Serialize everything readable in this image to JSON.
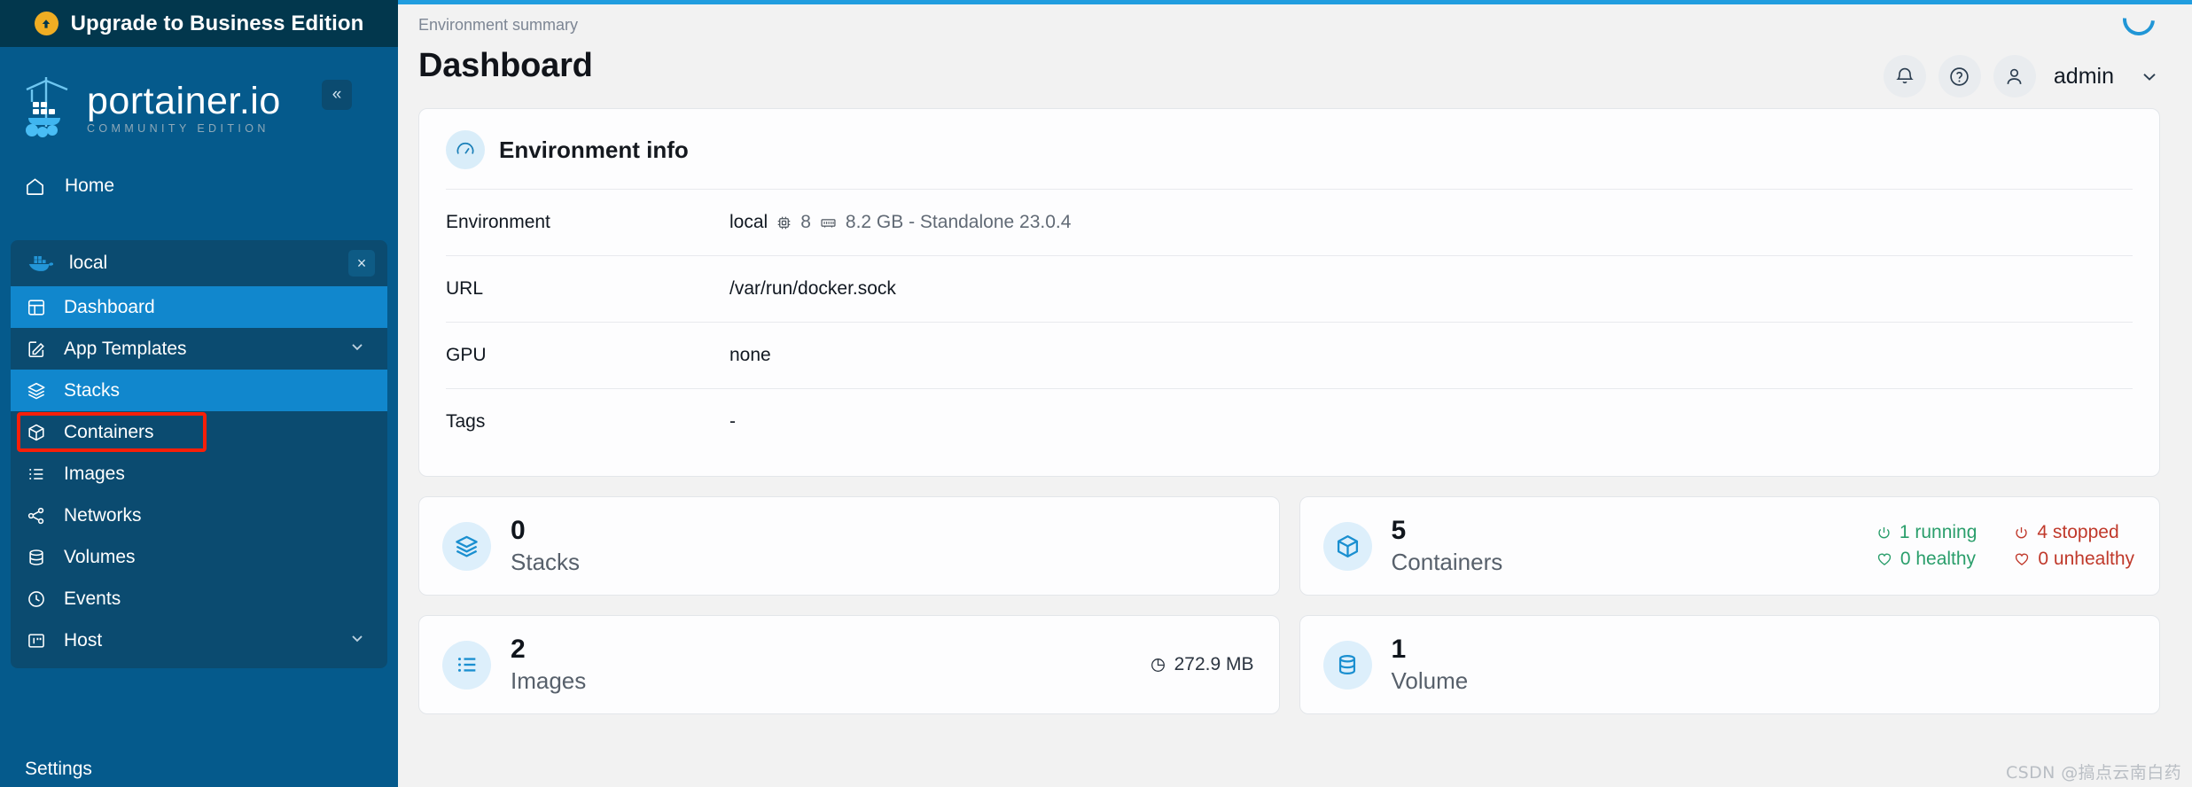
{
  "sidebar": {
    "upgrade_banner": {
      "label": "Upgrade to Business Edition",
      "icon": "up-arrow-circle-icon"
    },
    "logo": {
      "brand": "portainer.io",
      "edition": "COMMUNITY EDITION",
      "icon": "portainer-crane-logo"
    },
    "collapse_label": "«",
    "home": {
      "label": "Home",
      "icon": "home-icon"
    },
    "environment": {
      "name": "local",
      "icon": "docker-whale-icon",
      "close_label": "×"
    },
    "items": [
      {
        "label": "Dashboard",
        "icon": "dashboard-layout-icon",
        "active": true,
        "chevron": false,
        "highlighted": false
      },
      {
        "label": "App Templates",
        "icon": "edit-square-icon",
        "active": false,
        "chevron": true,
        "highlighted": false
      },
      {
        "label": "Stacks",
        "icon": "layers-icon",
        "active": true,
        "chevron": false,
        "highlighted": false
      },
      {
        "label": "Containers",
        "icon": "cube-icon",
        "active": false,
        "chevron": false,
        "highlighted": true
      },
      {
        "label": "Images",
        "icon": "list-icon",
        "active": false,
        "chevron": false,
        "highlighted": false
      },
      {
        "label": "Networks",
        "icon": "network-share-icon",
        "active": false,
        "chevron": false,
        "highlighted": false
      },
      {
        "label": "Volumes",
        "icon": "database-icon",
        "active": false,
        "chevron": false,
        "highlighted": false
      },
      {
        "label": "Events",
        "icon": "clock-icon",
        "active": false,
        "chevron": false,
        "highlighted": false
      },
      {
        "label": "Host",
        "icon": "server-panel-icon",
        "active": false,
        "chevron": true,
        "highlighted": false
      }
    ],
    "settings_label": "Settings"
  },
  "header": {
    "breadcrumb": "Environment summary",
    "title": "Dashboard",
    "notifications_icon": "bell-icon",
    "help_icon": "question-circle-icon",
    "user_icon": "user-avatar-icon",
    "user_name": "admin",
    "user_chevron_icon": "chevron-down-icon",
    "loading_icon": "spinner-icon"
  },
  "env_info": {
    "title": "Environment info",
    "icon": "gauge-icon",
    "rows": [
      {
        "label": "Environment",
        "value": "local",
        "cpu_icon": "cpu-chip-icon",
        "cpu": "8",
        "memory_icon": "memory-ram-icon",
        "memory": "8.2 GB - Standalone 23.0.4"
      },
      {
        "label": "URL",
        "value": "/var/run/docker.sock"
      },
      {
        "label": "GPU",
        "value": "none"
      },
      {
        "label": "Tags",
        "value": "-"
      }
    ]
  },
  "stats": {
    "stacks": {
      "count": "0",
      "label": "Stacks",
      "icon": "layers-icon"
    },
    "containers": {
      "count": "5",
      "label": "Containers",
      "icon": "cube-icon",
      "running": "1 running",
      "stopped": "4 stopped",
      "healthy": "0 healthy",
      "unhealthy": "0 unhealthy",
      "running_icon": "power-icon",
      "stopped_icon": "power-icon",
      "healthy_icon": "heart-icon",
      "unhealthy_icon": "heart-icon"
    },
    "images": {
      "count": "2",
      "label": "Images",
      "icon": "list-icon",
      "size": "272.9 MB",
      "size_icon": "pie-chart-icon"
    },
    "volumes": {
      "count": "1",
      "label": "Volume",
      "icon": "database-icon"
    }
  },
  "watermark": "CSDN @搞点云南白药",
  "colors": {
    "sidebar_bg": "#055a8c",
    "sidebar_banner_bg": "#02374d",
    "sidebar_group_bg": "#0b4b70",
    "accent_active": "#1187cd",
    "top_accent": "#219ddf",
    "highlight_box": "#f81f09",
    "upgrade_badge": "#f0ad23",
    "icon_blue": "#1a8fd0",
    "status_green": "#2a9e6b",
    "status_red": "#c0392b"
  }
}
